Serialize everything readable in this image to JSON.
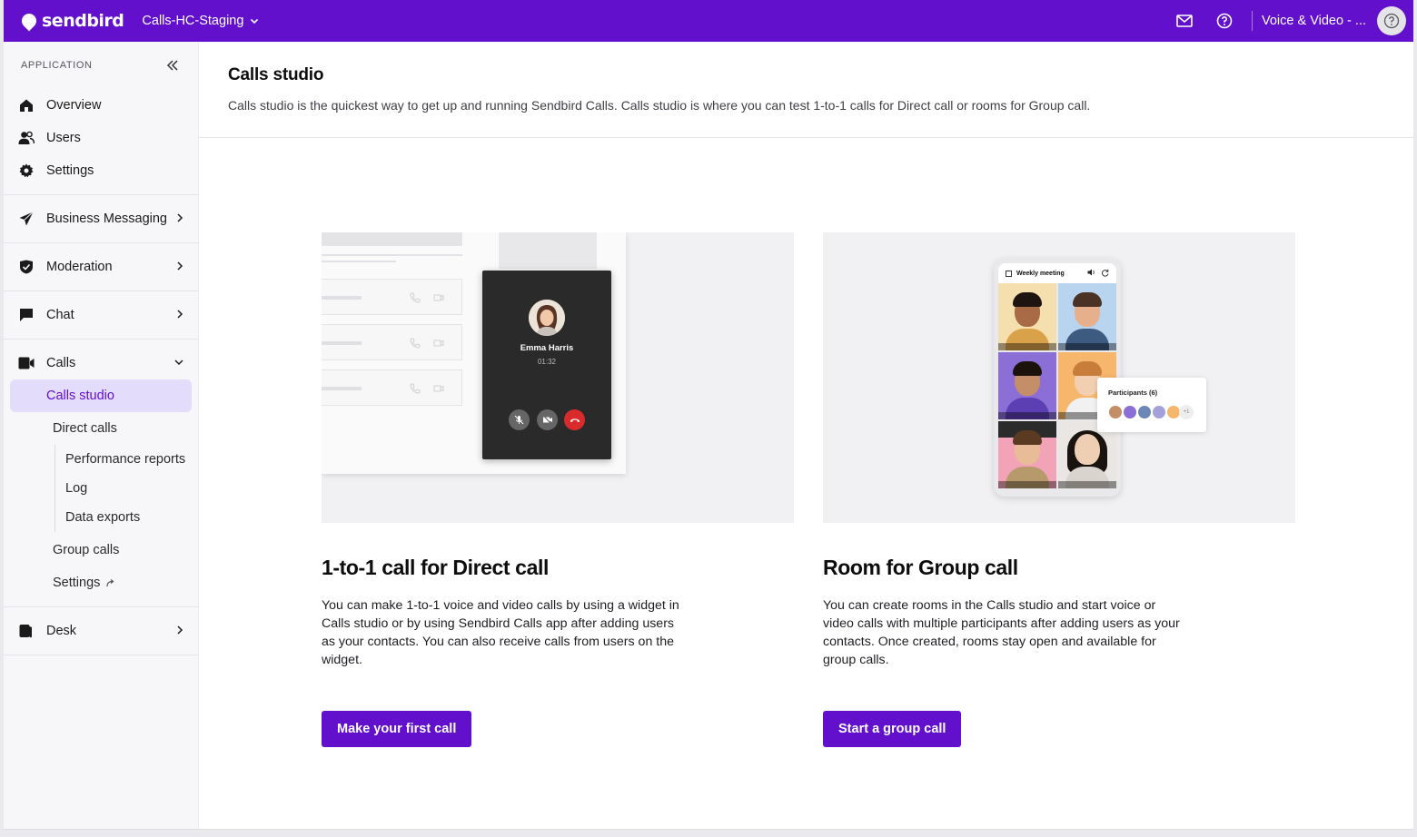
{
  "topbar": {
    "brand": "sendbird",
    "app_name": "Calls-HC-Staging",
    "org_name": "Voice & Video - ...",
    "icons": [
      "mail-icon",
      "help-icon",
      "avatar-icon"
    ]
  },
  "sidebar": {
    "section_title": "APPLICATION",
    "items": [
      {
        "label": "Overview",
        "icon": "home-icon"
      },
      {
        "label": "Users",
        "icon": "users-icon"
      },
      {
        "label": "Settings",
        "icon": "gear-icon"
      }
    ],
    "groups": [
      {
        "label": "Business Messaging",
        "icon": "send-icon"
      },
      {
        "label": "Moderation",
        "icon": "shield-icon"
      },
      {
        "label": "Chat",
        "icon": "chat-icon"
      }
    ],
    "calls": {
      "label": "Calls",
      "icon": "video-icon",
      "sub": {
        "calls_studio": "Calls studio",
        "direct_calls": "Direct calls",
        "performance_reports": "Performance reports",
        "log": "Log",
        "data_exports": "Data exports",
        "group_calls": "Group calls",
        "settings": "Settings"
      }
    },
    "desk": {
      "label": "Desk",
      "icon": "desk-icon"
    }
  },
  "main": {
    "title": "Calls studio",
    "description": "Calls studio is the quickest way to get up and running Sendbird Calls. Calls studio is where you can test 1-to-1 calls for Direct call or rooms for Group call.",
    "cards": [
      {
        "title": "1-to-1 call for Direct call",
        "description": "You can make 1-to-1 voice and video calls by using a widget in Calls studio or by using Sendbird Calls app after adding users as your contacts. You can also receive calls from users on the widget.",
        "button": "Make your first call",
        "illustration": {
          "caller_name": "Emma Harris",
          "call_time": "01:32"
        }
      },
      {
        "title": "Room for Group call",
        "description": "You can create rooms in the Calls studio and start voice or video calls with multiple participants after adding users as your contacts. Once created, rooms stay open and available for group calls.",
        "button": "Start a group call",
        "illustration": {
          "room_name": "Weekly meeting",
          "participants_label": "Participants (6)",
          "more_count": "+1"
        }
      }
    ]
  }
}
